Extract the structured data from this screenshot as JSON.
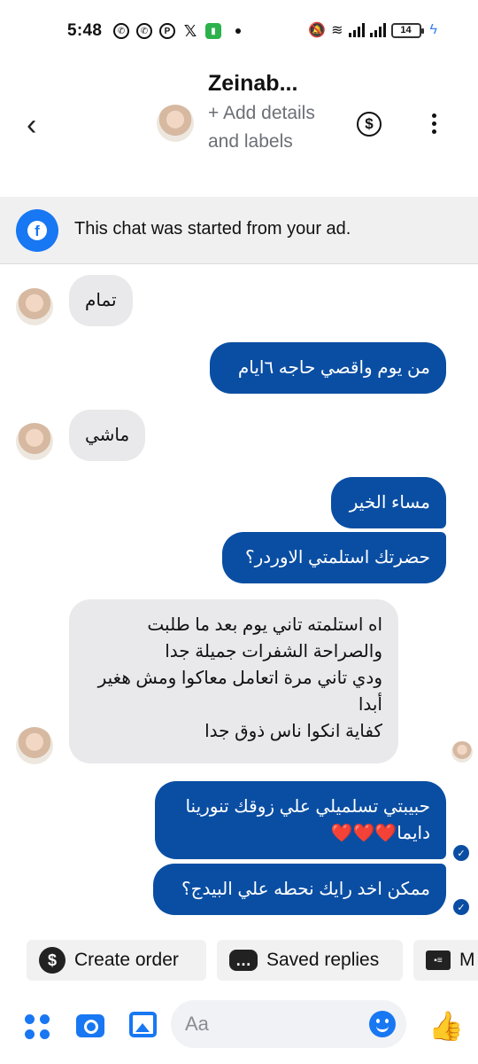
{
  "status_bar": {
    "time": "5:48",
    "battery": "14",
    "app_icons": [
      "whatsapp-icon",
      "whatsapp-business-icon",
      "pinterest-icon",
      "x-icon",
      "battery-saver-icon"
    ]
  },
  "header": {
    "name": "Zeinab...",
    "add_details": "+ Add details and labels"
  },
  "ad_banner": {
    "text": "This chat was started from your ad."
  },
  "messages": [
    {
      "dir": "in",
      "text": "تمام"
    },
    {
      "dir": "out",
      "text": "من يوم واقصي حاجه ٦ايام"
    },
    {
      "dir": "in",
      "text": "ماشي"
    },
    {
      "dir": "out",
      "text": "مساء الخير"
    },
    {
      "dir": "out",
      "text": "حضرتك استلمتي الاوردر؟"
    },
    {
      "dir": "in",
      "text": "اه استلمته تاني يوم بعد ما طلبت\nوالصراحة الشفرات جميلة جدا\nودي تاني مرة اتعامل معاكوا ومش هغير أبدا\nكفاية انكوا ناس ذوق جدا"
    },
    {
      "dir": "out",
      "text": "حبيبتي تسلميلي علي زوقك تنورينا دايما❤️❤️❤️"
    },
    {
      "dir": "out",
      "text": "ممكن اخد رايك نحطه علي البيدج؟"
    }
  ],
  "quick_replies": [
    {
      "label": "Create order",
      "icon": "dollar-icon"
    },
    {
      "label": "Saved replies",
      "icon": "chat-bubbles-icon"
    },
    {
      "label": "M",
      "icon": "contact-card-icon"
    }
  ],
  "composer": {
    "placeholder": "Aa"
  },
  "colors": {
    "outgoing_bubble": "#0a4ea3",
    "incoming_bubble": "#e9e9eb",
    "accent": "#1877f2",
    "banner_bg": "#f0f0f0"
  }
}
